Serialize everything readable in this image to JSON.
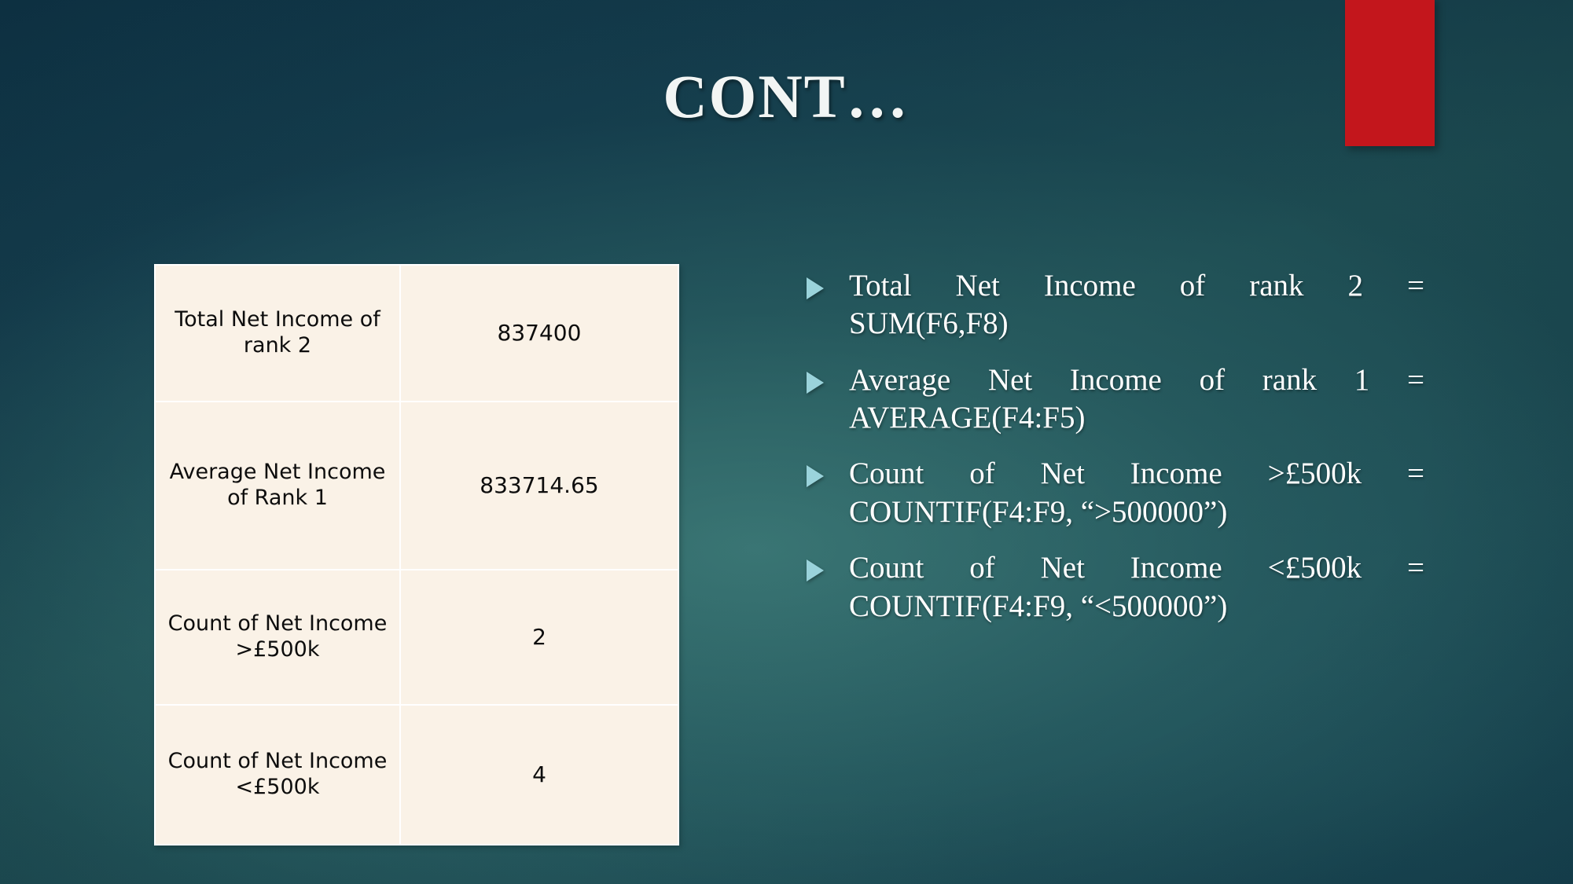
{
  "slide": {
    "title": "CONT…",
    "accent_color": "#c3161c",
    "bullet_marker_color": "#9ad3db",
    "background_color": "#1b4a52",
    "table_background": "#faf2e7"
  },
  "table": {
    "rows": [
      {
        "label": "Total Net Income of rank 2",
        "value": "837400"
      },
      {
        "label": "Average Net Income of Rank 1",
        "value": "833714.65"
      },
      {
        "label": "Count of Net Income >£500k",
        "value": "2"
      },
      {
        "label": "Count of Net Income <£500k",
        "value": "4"
      }
    ]
  },
  "bullets": [
    {
      "line1": "Total Net Income of rank 2 =",
      "line2": "SUM(F6,F8)"
    },
    {
      "line1": "Average Net Income of rank 1 =",
      "line2": "AVERAGE(F4:F5)"
    },
    {
      "line1": "Count of Net Income >£500k =",
      "line2": "COUNTIF(F4:F9, “>500000”)"
    },
    {
      "line1": "Count of Net Income <£500k =",
      "line2": "COUNTIF(F4:F9, “<500000”)"
    }
  ]
}
